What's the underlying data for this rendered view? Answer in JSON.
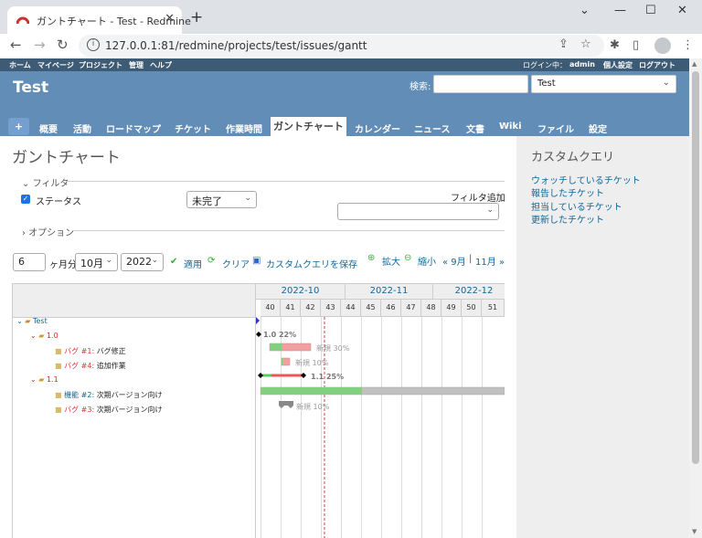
{
  "browser": {
    "tab_title": "ガントチャート - Test - Redmine",
    "url": "127.0.0.1:81/redmine/projects/test/issues/gantt"
  },
  "topmenu": {
    "left": [
      "ホーム",
      "マイページ",
      "プロジェクト",
      "管理",
      "ヘルプ"
    ],
    "logged_in_label": "ログイン中：",
    "user": "admin",
    "my_account": "個人設定",
    "logout": "ログアウト"
  },
  "header": {
    "project_title": "Test",
    "search_label": "検索:",
    "search_value": "",
    "project_select": "Test"
  },
  "mainmenu": {
    "items": [
      "概要",
      "活動",
      "ロードマップ",
      "チケット",
      "作業時間",
      "ガントチャート",
      "カレンダー",
      "ニュース",
      "文書",
      "Wiki",
      "ファイル",
      "設定"
    ],
    "selected": "ガントチャート"
  },
  "page": {
    "title": "ガントチャート"
  },
  "filters": {
    "legend": "フィルタ",
    "status_label": "ステータス",
    "status_value": "未完了",
    "add_filter_label": "フィルタ追加",
    "options_legend": "オプション"
  },
  "controls": {
    "months": "6",
    "months_label": "ヶ月分",
    "month_value": "10月",
    "year_value": "2022",
    "apply": "適用",
    "clear": "クリア",
    "save_query": "カスタムクエリを保存",
    "zoom_in": "拡大",
    "zoom_out": "縮小",
    "prev": "« 9月",
    "sep": "|",
    "next": "11月 »"
  },
  "gantt": {
    "months": [
      "2022-10",
      "2022-11",
      "2022-12"
    ],
    "weeks": [
      "40",
      "41",
      "42",
      "43",
      "44",
      "45",
      "46",
      "47",
      "48",
      "49",
      "50",
      "51"
    ],
    "rows": [
      {
        "kind": "project",
        "label": "Test"
      },
      {
        "kind": "version",
        "label": "1.0"
      },
      {
        "kind": "issue",
        "tracker": "バグ #1:",
        "subject": "バグ修正"
      },
      {
        "kind": "issue",
        "tracker": "バグ #4:",
        "subject": "追加作業"
      },
      {
        "kind": "version",
        "label": "1.1"
      },
      {
        "kind": "issue",
        "tracker": "機能 #2:",
        "subject": "次期バージョン向け"
      },
      {
        "kind": "issue",
        "tracker": "バグ #3:",
        "subject": "次期バージョン向け"
      }
    ],
    "bar_labels": {
      "v10": "1.0 22%",
      "i1": "新規 30%",
      "i4": "新規 10%",
      "v11": "1.1 25%",
      "i3": "新規 10%"
    },
    "progress": {
      "v10": 0.22,
      "i1": 0.3,
      "i4": 0.1,
      "v11": 0.25,
      "i3": 0.1
    }
  },
  "sidebar": {
    "heading": "カスタムクエリ",
    "links": [
      "ウォッチしているチケット",
      "報告したチケット",
      "担当しているチケット",
      "更新したチケット"
    ]
  },
  "colors": {
    "topmenu": "#3e5b76",
    "header": "#628db6",
    "link": "#116699",
    "version": "#d22",
    "done": "#80d080",
    "late": "#f0a0a0",
    "todo": "#c0c0c0"
  }
}
